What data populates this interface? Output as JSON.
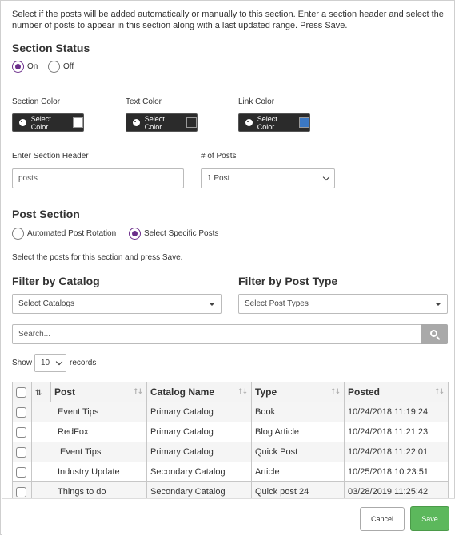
{
  "intro": "Select if the posts will be added automatically or manually to this section. Enter a section header and select the number of posts to appear in this section along with a last updated range. Press Save.",
  "section_status": {
    "title": "Section Status",
    "on_label": "On",
    "off_label": "Off",
    "selected": "On"
  },
  "colors": {
    "section": {
      "label": "Section Color",
      "button": "Select Color",
      "swatch": "#ffffff"
    },
    "text": {
      "label": "Text Color",
      "button": "Select Color",
      "swatch": "#2b2b2b"
    },
    "link": {
      "label": "Link Color",
      "button": "Select Color",
      "swatch": "#3b78c4"
    }
  },
  "header_field": {
    "label": "Enter Section Header",
    "value": "posts"
  },
  "num_posts": {
    "label": "# of Posts",
    "value": "1 Post"
  },
  "post_section": {
    "title": "Post Section",
    "option_auto": "Automated Post Rotation",
    "option_specific": "Select Specific Posts",
    "selected": "Select Specific Posts",
    "instruction": "Select the posts for this section and press Save."
  },
  "filter_catalog": {
    "title": "Filter by Catalog",
    "placeholder": "Select Catalogs"
  },
  "filter_type": {
    "title": "Filter by Post Type",
    "placeholder": "Select Post Types"
  },
  "search": {
    "placeholder": "Search..."
  },
  "show": {
    "prefix": "Show",
    "value": "10",
    "suffix": "records"
  },
  "table": {
    "columns": [
      "Post",
      "Catalog Name",
      "Type",
      "Posted"
    ],
    "rows": [
      {
        "post": "Event Tips",
        "catalog": "Primary Catalog",
        "type": "Book",
        "posted": "10/24/2018 11:19:24"
      },
      {
        "post": "RedFox",
        "catalog": "Primary Catalog",
        "type": "Blog Article",
        "posted": "10/24/2018 11:21:23"
      },
      {
        "post": "Event Tips",
        "catalog": "Primary Catalog",
        "type": "Quick Post",
        "posted": "10/24/2018 11:22:01"
      },
      {
        "post": "Industry Update",
        "catalog": "Secondary Catalog",
        "type": "Article",
        "posted": "10/25/2018 10:23:51"
      },
      {
        "post": "Things to do",
        "catalog": "Secondary Catalog",
        "type": "Quick post 24",
        "posted": "03/28/2019 11:25:42"
      }
    ]
  },
  "footer": {
    "cancel": "Cancel",
    "save": "Save"
  },
  "accent": "#6b2d8a",
  "save_color": "#5cb85c"
}
